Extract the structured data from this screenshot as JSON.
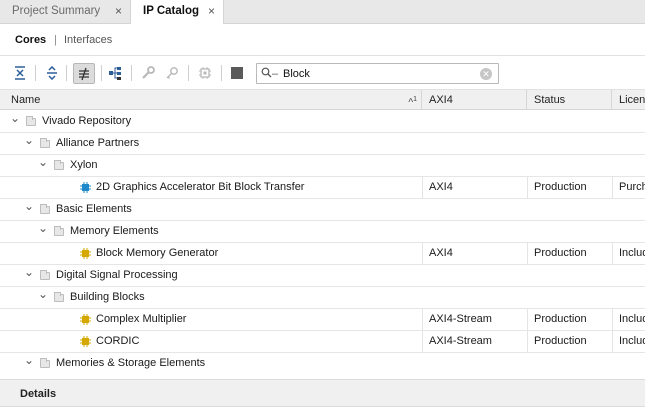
{
  "tabs": [
    {
      "label": "Project Summary",
      "active": false
    },
    {
      "label": "IP Catalog",
      "active": true
    }
  ],
  "tab_close_glyph": "×",
  "subnav": {
    "cores": "Cores",
    "separator": "|",
    "interfaces": "Interfaces"
  },
  "toolbar": {
    "icons": [
      "collapse-all-icon",
      "expand-all-icon",
      "filter-toggle-icon",
      "hierarchy-icon",
      "wrench-icon",
      "key-icon",
      "chip-icon",
      "stop-icon"
    ],
    "search_value": "Block"
  },
  "table": {
    "columns": {
      "name": "Name",
      "axi": "AXI4",
      "status": "Status",
      "license": "License"
    },
    "sort_indicator": "^",
    "sort_rank": "1",
    "rows": [
      {
        "label": "Vivado Repository",
        "kind": "folder",
        "level": 0,
        "axi": "",
        "status": "",
        "license": ""
      },
      {
        "label": "Alliance Partners",
        "kind": "folder",
        "level": 1,
        "axi": "",
        "status": "",
        "license": ""
      },
      {
        "label": "Xylon",
        "kind": "folder",
        "level": 2,
        "axi": "",
        "status": "",
        "license": ""
      },
      {
        "label": "2D Graphics Accelerator Bit Block Transfer",
        "kind": "ip",
        "level": 3,
        "axi": "AXI4",
        "status": "Production",
        "license": "Purchase"
      },
      {
        "label": "Basic Elements",
        "kind": "folder",
        "level": 1,
        "axi": "",
        "status": "",
        "license": ""
      },
      {
        "label": "Memory Elements",
        "kind": "folder",
        "level": 2,
        "axi": "",
        "status": "",
        "license": ""
      },
      {
        "label": "Block Memory Generator",
        "kind": "ip",
        "level": 3,
        "axi": "AXI4",
        "status": "Production",
        "license": "Included"
      },
      {
        "label": "Digital Signal Processing",
        "kind": "folder",
        "level": 1,
        "axi": "",
        "status": "",
        "license": ""
      },
      {
        "label": "Building Blocks",
        "kind": "folder",
        "level": 2,
        "axi": "",
        "status": "",
        "license": ""
      },
      {
        "label": "Complex Multiplier",
        "kind": "ip",
        "level": 3,
        "axi": "AXI4-Stream",
        "status": "Production",
        "license": "Included"
      },
      {
        "label": "CORDIC",
        "kind": "ip",
        "level": 3,
        "axi": "AXI4-Stream",
        "status": "Production",
        "license": "Included"
      },
      {
        "label": "Memories & Storage Elements",
        "kind": "folder",
        "level": 1,
        "axi": "",
        "status": "",
        "license": ""
      }
    ]
  },
  "details": {
    "title": "Details"
  },
  "colors": {
    "ip_icon_blue": "#1e88c8",
    "ip_icon_yellow": "#d4a800"
  }
}
